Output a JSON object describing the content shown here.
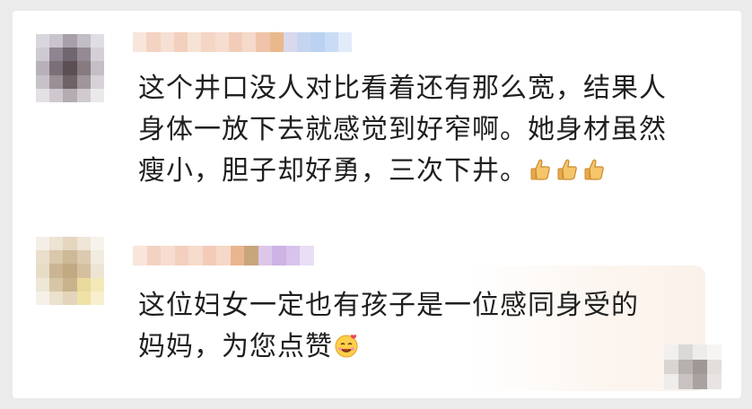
{
  "comments": [
    {
      "text_lines": [
        "这个井口没人对比看着还有那么宽，结果人",
        "身体一放下去就感觉到好窄啊。她身材虽然",
        "瘦小，胆子却好勇，三次下井。"
      ],
      "emoji_names": [
        "thumbs-up",
        "thumbs-up",
        "thumbs-up"
      ]
    },
    {
      "text_lines": [
        "这位妇女一定也有孩子是一位感同身受的",
        "妈妈，为您点赞"
      ],
      "emoji_names": [
        "smiling-face-with-hearts"
      ]
    }
  ],
  "colors": {
    "background": "#ebebeb",
    "card": "#ffffff",
    "text": "#1f1f1f",
    "reply_highlight": "#fbf1ea"
  }
}
